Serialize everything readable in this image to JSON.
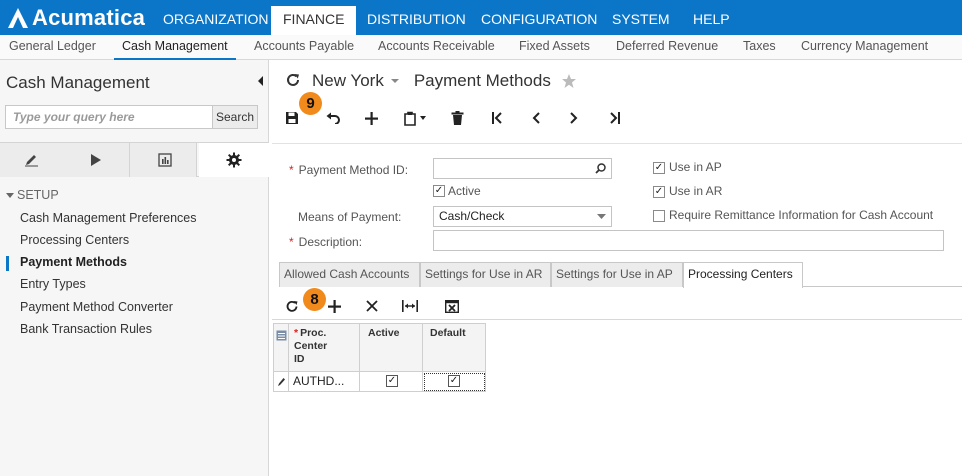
{
  "brand": {
    "name": "Acumatica"
  },
  "topnav": [
    "ORGANIZATION",
    "FINANCE",
    "DISTRIBUTION",
    "CONFIGURATION",
    "SYSTEM",
    "HELP"
  ],
  "subnav": [
    "General Ledger",
    "Cash Management",
    "Accounts Payable",
    "Accounts Receivable",
    "Fixed Assets",
    "Deferred Revenue",
    "Taxes",
    "Currency Management"
  ],
  "sidebar": {
    "title": "Cash Management",
    "search_placeholder": "Type your query here",
    "search_button": "Search",
    "section": "SETUP",
    "items": [
      "Cash Management Preferences",
      "Processing Centers",
      "Payment Methods",
      "Entry Types",
      "Payment Method Converter",
      "Bank Transaction Rules"
    ],
    "active_item": "Payment Methods"
  },
  "page": {
    "company": "New York",
    "title": "Payment Methods"
  },
  "badges": {
    "toolbar": "9",
    "grid": "8"
  },
  "form": {
    "payment_method_id_label": "Payment Method ID:",
    "payment_method_id_value": "",
    "active_label": "Active",
    "active_checked": true,
    "means_label": "Means of Payment:",
    "means_value": "Cash/Check",
    "description_label": "Description:",
    "description_value": "",
    "use_in_ap_label": "Use in AP",
    "use_in_ap_checked": true,
    "use_in_ar_label": "Use in AR",
    "use_in_ar_checked": true,
    "require_remit_label": "Require Remittance Information for Cash Account",
    "require_remit_checked": false
  },
  "tabs": [
    "Allowed Cash Accounts",
    "Settings for Use in AR",
    "Settings for Use in AP",
    "Processing Centers"
  ],
  "active_tab": "Processing Centers",
  "grid": {
    "headers": [
      "Proc.\nCenter\nID",
      "Active",
      "Default"
    ],
    "rows": [
      {
        "proc_center_id": "AUTHD...",
        "active": true,
        "default": true
      }
    ]
  },
  "colors": {
    "brand_blue": "#0b75c7",
    "badge_orange": "#f08a1c",
    "required_red": "#d22222"
  }
}
